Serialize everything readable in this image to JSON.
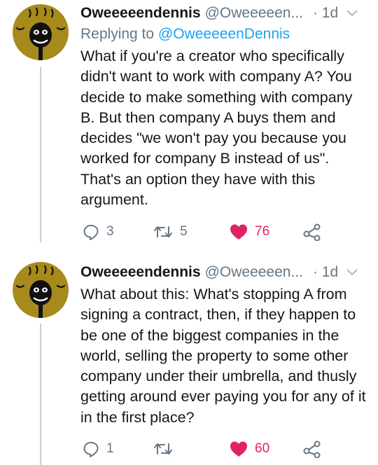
{
  "colors": {
    "accent": "#1da1f2",
    "like": "#e0245e",
    "muted": "#657786",
    "text": "#14171a",
    "avatar_bg": "#a68a1c"
  },
  "tweets": [
    {
      "name": "Oweeeeendennis",
      "handle": "@Oweeeeen...",
      "time": "· 1d",
      "replying_label": "Replying to",
      "replying_to": "@OweeeeenDennis",
      "text": "What if you're a creator who specifically didn't want to work with company A? You decide to make something with company B. But then company A buys them and decides \"we won't pay you because you worked for company B instead of us\". That's an option they have with this argument.",
      "replies": "3",
      "retweets": "5",
      "likes": "76",
      "liked": true
    },
    {
      "name": "Oweeeeendennis",
      "handle": "@Oweeeeen...",
      "time": "· 1d",
      "text": "What about this: What's stopping A from signing a contract, then, if they happen to be one of the biggest companies in the world, selling the property to some other company under their umbrella, and thusly getting around ever paying you for any of it in the first place?",
      "replies": "1",
      "retweets": "",
      "likes": "60",
      "liked": true
    }
  ],
  "icons": {
    "avatar": "cartoon-face-avatar",
    "caret": "chevron-down-icon",
    "reply": "reply-icon",
    "retweet": "retweet-icon",
    "like": "heart-icon",
    "share": "share-icon"
  }
}
